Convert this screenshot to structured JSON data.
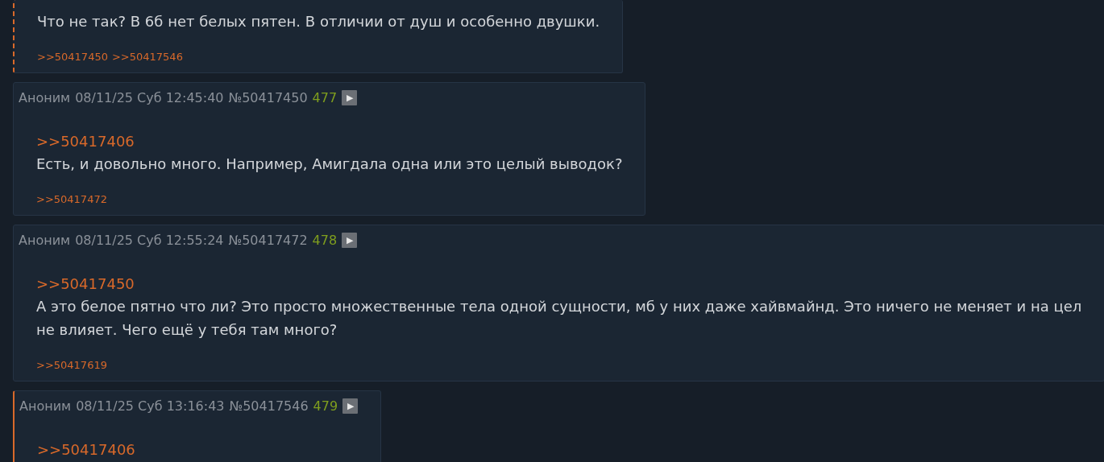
{
  "posts": [
    {
      "kind": "dashed",
      "text": "Что не так? В 6б нет белых пятен. В отличии от душ и особенно двушки.",
      "backlinks": [
        ">>50417450",
        ">>50417546"
      ]
    },
    {
      "kind": "plain",
      "header": {
        "name": "Аноним",
        "date": "08/11/25 Суб 12:45:40",
        "number": "№50417450",
        "count": "477",
        "play": "▶"
      },
      "quote": ">>50417406",
      "text": "Есть, и довольно много. Например, Амигдала одна или это целый выводок?",
      "backlinks": [
        ">>50417472"
      ]
    },
    {
      "kind": "plain",
      "header": {
        "name": "Аноним",
        "date": "08/11/25 Суб 12:55:24",
        "number": "№50417472",
        "count": "478",
        "play": "▶"
      },
      "quote": ">>50417450",
      "text": "А это белое пятно что ли? Это просто множественные тела одной сущности, мб у них даже хайвмайнд. Это ничего не меняет и на цел\nне влияет. Чего ещё у тебя там много?",
      "backlinks": [
        ">>50417619"
      ]
    },
    {
      "kind": "solid",
      "header": {
        "name": "Аноним",
        "date": "08/11/25 Суб 13:16:43",
        "number": "№50417546",
        "count": "479",
        "play": "▶"
      },
      "quote": ">>50417406"
    }
  ]
}
